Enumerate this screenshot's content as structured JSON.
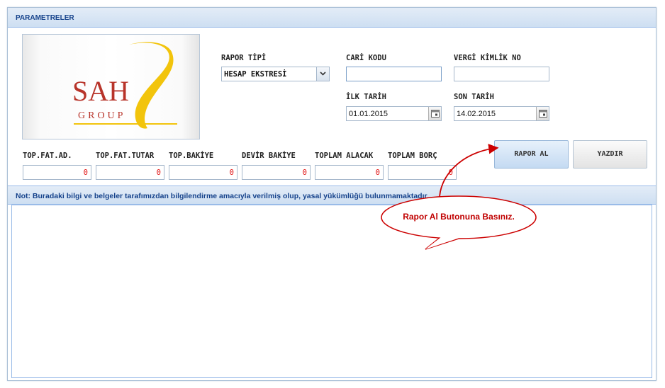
{
  "panel": {
    "title": "PARAMETRELER"
  },
  "logo": {
    "brand": "SAH",
    "sub": "GROUP"
  },
  "form": {
    "rapor_tipi_label": "RAPOR TİPİ",
    "rapor_tipi_value": "HESAP EKSTRESİ",
    "cari_kodu_label": "CARİ KODU",
    "cari_kodu_value": "",
    "vergi_label": "VERGİ KİMLİK NO",
    "vergi_value": "",
    "ilk_tarih_label": "İLK TARİH",
    "ilk_tarih_value": "01.01.2015",
    "son_tarih_label": "SON TARİH",
    "son_tarih_value": "14.02.2015"
  },
  "totals": [
    {
      "label": "TOP.FAT.AD.",
      "value": "0"
    },
    {
      "label": "TOP.FAT.TUTAR",
      "value": "0"
    },
    {
      "label": "TOP.BAKİYE",
      "value": "0"
    },
    {
      "label": "DEVİR BAKİYE",
      "value": "0"
    },
    {
      "label": "TOPLAM ALACAK",
      "value": "0"
    },
    {
      "label": "TOPLAM BORÇ",
      "value": "0"
    }
  ],
  "buttons": {
    "rapor_al": "RAPOR AL",
    "yazdir": "YAZDIR"
  },
  "note": "Not: Buradaki bilgi ve belgeler tarafımızdan bilgilendirme amacıyla verilmiş olup, yasal yükümlüğü bulunmamaktadır.",
  "callout": "Rapor Al Butonuna Basınız.",
  "colors": {
    "header_text": "#15428b",
    "zero_value": "#e01010",
    "callout_red": "#cc0000",
    "logo_red": "#b8342a",
    "logo_yellow": "#f2c40c"
  }
}
